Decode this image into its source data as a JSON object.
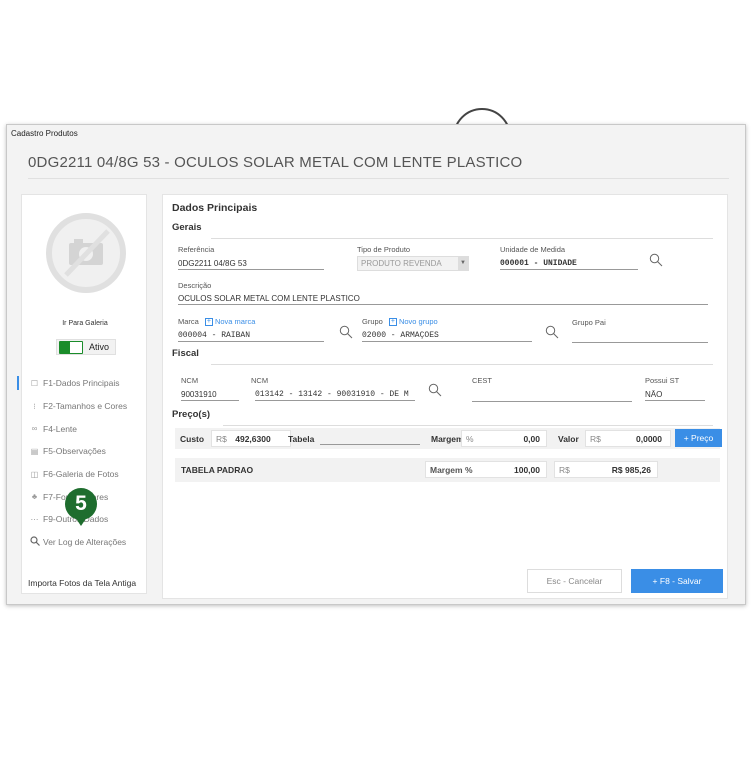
{
  "window": {
    "title": "Cadastro Produtos"
  },
  "product_title": "0DG2211 04/8G 53 - OCULOS SOLAR METAL COM LENTE PLASTICO",
  "left": {
    "gallery_link": "Ir Para Galeria",
    "active_label": "Ativo",
    "badge": "5",
    "nav": [
      {
        "icon": "principal-icon",
        "label": "F1-Dados Principais"
      },
      {
        "icon": "sizes-icon",
        "label": "F2-Tamanhos e Cores"
      },
      {
        "icon": "glasses-icon",
        "label": "F4-Lente"
      },
      {
        "icon": "notes-icon",
        "label": "F5-Observações"
      },
      {
        "icon": "photo-icon",
        "label": "F6-Galeria de Fotos"
      },
      {
        "icon": "suppliers-icon",
        "label": "F7-Fornecedores"
      },
      {
        "icon": "dots-icon",
        "label": "F9-Outros Dados"
      },
      {
        "icon": "search-icon",
        "label": "Ver Log de Alterações"
      }
    ],
    "import_label": "Importa Fotos da Tela Antiga"
  },
  "main": {
    "section_title": "Dados Principais",
    "gerais": {
      "heading": "Gerais",
      "referencia_label": "Referência",
      "referencia": "0DG2211 04/8G 53",
      "tipo_label": "Tipo de Produto",
      "tipo": "PRODUTO REVENDA",
      "unidade_label": "Unidade de Medida",
      "unidade": "000001 - UNIDADE",
      "descricao_label": "Descrição",
      "descricao": "OCULOS SOLAR METAL COM LENTE PLASTICO",
      "marca_label": "Marca",
      "nova_marca": "Nova marca",
      "marca": "000004 - RAIBAN",
      "grupo_label": "Grupo",
      "novo_grupo": "Novo grupo",
      "grupo": "02000 - ARMAÇÕES",
      "grupo_pai_label": "Grupo Pai",
      "grupo_pai": ""
    },
    "fiscal": {
      "heading": "Fiscal",
      "ncm_label": "NCM",
      "ncm": "90031910",
      "ncm2_label": "NCM",
      "ncm2": "013142 - 13142 - 90031910 - DE M",
      "cest_label": "CEST",
      "cest": "",
      "possui_st_label": "Possui ST",
      "possui_st": "NÃO"
    },
    "precos": {
      "heading": "Preço(s)",
      "custo_label": "Custo",
      "currency": "R$",
      "custo": "492,6300",
      "tabela_label": "Tabela",
      "tabela": "",
      "margem_label": "Margem",
      "percent": "%",
      "margem": "0,00",
      "valor_label": "Valor",
      "valor": "0,0000",
      "preco_button": "+ Preço",
      "table_name": "TABELA PADRAO",
      "table_margem_label": "Margem %",
      "table_margem": "100,00",
      "table_currency": "R$",
      "table_valor": "R$ 985,26"
    },
    "cancel_button": "Esc - Cancelar",
    "save_button": "+   F8 - Salvar"
  }
}
